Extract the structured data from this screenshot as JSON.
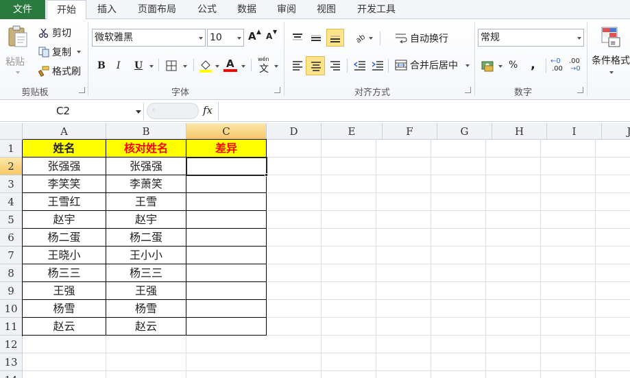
{
  "tabs": {
    "file": "文件",
    "items": [
      "开始",
      "插入",
      "页面布局",
      "公式",
      "数据",
      "审阅",
      "视图",
      "开发工具"
    ],
    "active_index": 0
  },
  "ribbon": {
    "clipboard": {
      "paste": "粘贴",
      "cut": "剪切",
      "copy": "复制",
      "format_painter": "格式刷",
      "group_label": "剪贴板"
    },
    "font": {
      "font_name": "微软雅黑",
      "font_size": "10",
      "group_label": "字体",
      "bold": "B",
      "italic": "I",
      "underline": "U",
      "grow": "A",
      "shrink": "A",
      "font_color_letter": "A",
      "wen": "wén",
      "wen_char": "文"
    },
    "alignment": {
      "wrap_text": "自动换行",
      "merge_center": "合并后居中",
      "group_label": "对齐方式"
    },
    "number": {
      "format": "常规",
      "percent": "%",
      "comma": ",",
      "inc_decimal": ".00",
      "dec_decimal": ".00",
      "group_label": "数字"
    },
    "styles": {
      "conditional_format": "条件格式"
    }
  },
  "formula_bar": {
    "name_box": "C2",
    "fx": "fx",
    "value": ""
  },
  "sheet": {
    "columns": [
      "A",
      "B",
      "C",
      "D",
      "E",
      "F",
      "G",
      "H",
      "I",
      "J"
    ],
    "rows": [
      "1",
      "2",
      "3",
      "4",
      "5",
      "6",
      "7",
      "8",
      "9",
      "10",
      "11",
      "12",
      "13",
      "14"
    ],
    "header_row": {
      "a": "姓名",
      "b": "核对姓名",
      "c": "差异"
    },
    "data": [
      {
        "a": "张强强",
        "b": "张强强",
        "c": ""
      },
      {
        "a": "李笑笑",
        "b": "李萧笑",
        "c": ""
      },
      {
        "a": "王雪红",
        "b": "王雪",
        "c": ""
      },
      {
        "a": "赵宇",
        "b": "赵宇",
        "c": ""
      },
      {
        "a": "杨二蛋",
        "b": "杨二蛋",
        "c": ""
      },
      {
        "a": "王晓小",
        "b": "王小小",
        "c": ""
      },
      {
        "a": "杨三三",
        "b": "杨三三",
        "c": ""
      },
      {
        "a": "王强",
        "b": "王强",
        "c": ""
      },
      {
        "a": "杨雪",
        "b": "杨雪",
        "c": ""
      },
      {
        "a": "赵云",
        "b": "赵云",
        "c": ""
      }
    ],
    "active_cell": "C2",
    "colors": {
      "header_fill": "#ffff00",
      "header_red_text": "#ff0000",
      "file_tab": "#2a7a3f",
      "selection_header": "#f6c768"
    }
  }
}
